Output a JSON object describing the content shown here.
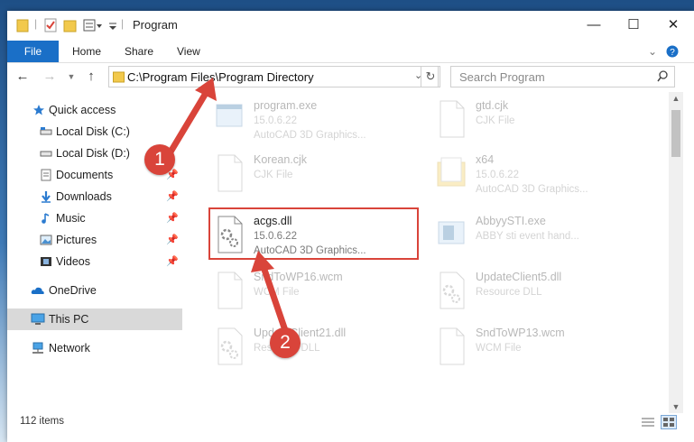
{
  "window": {
    "title": "Program"
  },
  "ribbon": {
    "tabs": [
      "File",
      "Home",
      "Share",
      "View"
    ]
  },
  "nav": {
    "address": "C:\\Program Files\\Program Directory",
    "search_placeholder": "Search Program"
  },
  "sidebar": {
    "items": [
      {
        "label": "Quick access",
        "icon": "star-icon"
      },
      {
        "label": "Local Disk (C:)",
        "icon": "drive-icon"
      },
      {
        "label": "Local Disk (D:)",
        "icon": "drive-icon"
      },
      {
        "label": "Documents",
        "icon": "documents-icon",
        "pinned": true
      },
      {
        "label": "Downloads",
        "icon": "downloads-icon",
        "pinned": true
      },
      {
        "label": "Music",
        "icon": "music-icon",
        "pinned": true
      },
      {
        "label": "Pictures",
        "icon": "pictures-icon",
        "pinned": true
      },
      {
        "label": "Videos",
        "icon": "videos-icon",
        "pinned": true
      },
      {
        "label": "OneDrive",
        "icon": "cloud-icon"
      },
      {
        "label": "This PC",
        "icon": "computer-icon",
        "selected": true
      },
      {
        "label": "Network",
        "icon": "network-icon"
      }
    ]
  },
  "files": [
    {
      "name": "program.exe",
      "version": "15.0.6.22",
      "desc": "AutoCAD 3D Graphics...",
      "icon": "exe-icon"
    },
    {
      "name": "gtd.cjk",
      "version": "CJK File",
      "desc": "",
      "icon": "file-icon"
    },
    {
      "name": "Korean.cjk",
      "version": "CJK File",
      "desc": "",
      "icon": "file-icon"
    },
    {
      "name": "x64",
      "version": "15.0.6.22",
      "desc": "AutoCAD 3D Graphics...",
      "icon": "folder-icon"
    },
    {
      "name": "acgs.dll",
      "version": "15.0.6.22",
      "desc": "AutoCAD 3D Graphics...",
      "icon": "dll-gear-icon"
    },
    {
      "name": "AbbyySTI.exe",
      "version": "ABBY sti event hand...",
      "desc": "",
      "icon": "exe-icon"
    },
    {
      "name": "SndToWP16.wcm",
      "version": "WCM File",
      "desc": "",
      "icon": "file-icon"
    },
    {
      "name": "UpdateClient5.dll",
      "version": "Resource DLL",
      "desc": "",
      "icon": "dll-gear-icon"
    },
    {
      "name": "UpdateClient21.dll",
      "version": "Resource DLL",
      "desc": "",
      "icon": "dll-gear-icon"
    },
    {
      "name": "SndToWP13.wcm",
      "version": "WCM File",
      "desc": "",
      "icon": "file-icon"
    }
  ],
  "status": {
    "count": "112 items"
  },
  "callouts": [
    "1",
    "2"
  ],
  "colors": {
    "accent": "#1a6fc7",
    "callout": "#d9443a",
    "selected": "#d9d9d9"
  }
}
